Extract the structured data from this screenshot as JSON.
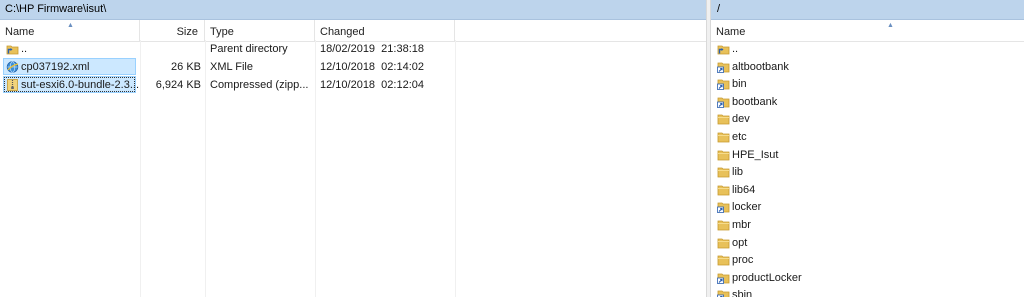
{
  "left_panel": {
    "path": "C:\\HP Firmware\\isut\\",
    "columns": {
      "name": "Name",
      "size": "Size",
      "type": "Type",
      "changed": "Changed"
    },
    "files": [
      {
        "name": "..",
        "size": "",
        "type": "Parent directory",
        "changed": "18/02/2019  21:38:18",
        "icon": "parent-folder-icon"
      },
      {
        "name": "cp037192.xml",
        "size": "26 KB",
        "type": "XML File",
        "changed": "12/10/2018  02:14:02",
        "icon": "xml-file-icon"
      },
      {
        "name": "sut-esxi6.0-bundle-2.3....",
        "size": "6,924 KB",
        "type": "Compressed (zipp...",
        "changed": "12/10/2018  02:12:04",
        "icon": "zip-file-icon"
      }
    ]
  },
  "right_panel": {
    "path": "/",
    "columns": {
      "name": "Name"
    },
    "files": [
      {
        "name": "..",
        "icon": "parent-folder-icon"
      },
      {
        "name": "altbootbank",
        "icon": "folder-link-icon"
      },
      {
        "name": "bin",
        "icon": "folder-link-icon"
      },
      {
        "name": "bootbank",
        "icon": "folder-link-icon"
      },
      {
        "name": "dev",
        "icon": "folder-icon"
      },
      {
        "name": "etc",
        "icon": "folder-icon"
      },
      {
        "name": "HPE_Isut",
        "icon": "folder-icon"
      },
      {
        "name": "lib",
        "icon": "folder-icon"
      },
      {
        "name": "lib64",
        "icon": "folder-icon"
      },
      {
        "name": "locker",
        "icon": "folder-link-icon"
      },
      {
        "name": "mbr",
        "icon": "folder-icon"
      },
      {
        "name": "opt",
        "icon": "folder-icon"
      },
      {
        "name": "proc",
        "icon": "folder-icon"
      },
      {
        "name": "productLocker",
        "icon": "folder-link-icon"
      },
      {
        "name": "sbin",
        "icon": "folder-link-icon"
      }
    ]
  },
  "colors": {
    "path_bar": "#bdd4ec",
    "selection_fill": "#cce8ff",
    "selection_border": "#99d1ff",
    "folder": "#e8c15a",
    "shortcut_arrow": "#2a5fb0"
  }
}
